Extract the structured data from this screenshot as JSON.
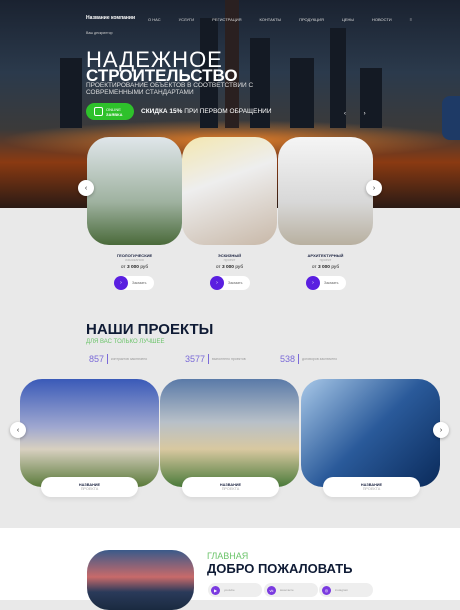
{
  "header": {
    "company": "Название компании",
    "descriptor": "Ваш дескриптор",
    "nav": [
      "О НАС",
      "УСЛУГИ",
      "РЕГИСТРАЦИЯ",
      "КОНТАКТЫ",
      "ПРОДУКЦИЯ",
      "ЦЕНЫ",
      "НОВОСТИ"
    ]
  },
  "hero": {
    "title_light": "НАДЕЖНОЕ",
    "title_bold": "СТРОИТЕЛЬСТВО",
    "subtitle": "ПРОЕКТИРОВАНИЕ ОБЪЕКТОВ В СООТВЕТСТВИИ С СОВРЕМЕННЫМИ СТАНДАРТАМИ",
    "cta_line1": "ONLINE",
    "cta_line2": "ЗАЯВКА",
    "discount_bold": "СКИДКА 15%",
    "discount_rest": "ПРИ ПЕРВОМ ОБРАЩЕНИИ"
  },
  "services": [
    {
      "title": "ГЕОЛОГИЧЕСКИЕ",
      "sub": "изыскания",
      "price_prefix": "от",
      "price": "3 000",
      "unit": "руб",
      "button": "Заказать"
    },
    {
      "title": "ЭСКИЗНЫЙ",
      "sub": "проект",
      "price_prefix": "от",
      "price": "3 000",
      "unit": "руб",
      "button": "Заказать"
    },
    {
      "title": "АРХИТЕКТУРНЫЙ",
      "sub": "проект",
      "price_prefix": "от",
      "price": "3 000",
      "unit": "руб",
      "button": "Заказать"
    }
  ],
  "projects": {
    "title": "НАШИ ПРОЕКТЫ",
    "subtitle": "ДЛЯ ВАС ТОЛЬКО ЛУЧШЕЕ",
    "stats": [
      {
        "value": "857",
        "label": "контрактов заключено"
      },
      {
        "value": "3577",
        "label": "выполнено проектов"
      },
      {
        "value": "538",
        "label": "договоров заключено"
      }
    ],
    "items": [
      {
        "name": "НАЗВАНИЕ",
        "sub": "ПРОЕКТА"
      },
      {
        "name": "НАЗВАНИЕ",
        "sub": "ПРОЕКТА"
      },
      {
        "name": "НАЗВАНИЕ",
        "sub": "ПРОЕКТА"
      }
    ]
  },
  "welcome": {
    "kicker": "ГЛАВНАЯ",
    "title": "ДОБРО ПОЖАЛОВАТЬ",
    "social": [
      {
        "icon": "youtube-icon",
        "glyph": "▶",
        "label": "youtube"
      },
      {
        "icon": "vk-icon",
        "glyph": "vk",
        "label": "вконтакте"
      },
      {
        "icon": "instagram-icon",
        "glyph": "◎",
        "label": "instagram"
      }
    ]
  },
  "colors": {
    "accent": "#5a1fe0",
    "green": "#2ec12b",
    "navy": "#0f1b35"
  }
}
